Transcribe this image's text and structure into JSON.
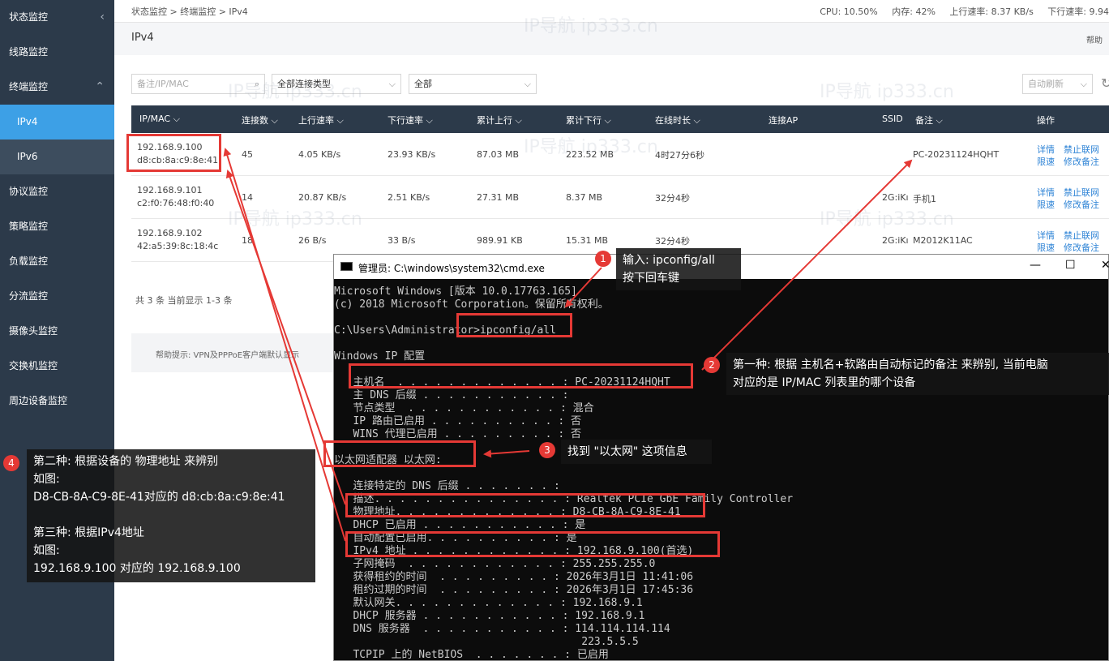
{
  "sidebar": {
    "items": [
      {
        "label": "状态监控",
        "chev": "‹"
      },
      {
        "label": "线路监控",
        "chev": ""
      },
      {
        "label": "终端监控",
        "chev": "⌃"
      },
      {
        "label": "IPv4",
        "chev": ""
      },
      {
        "label": "IPv6",
        "chev": ""
      },
      {
        "label": "协议监控",
        "chev": ""
      },
      {
        "label": "策略监控",
        "chev": ""
      },
      {
        "label": "负载监控",
        "chev": ""
      },
      {
        "label": "分流监控",
        "chev": ""
      },
      {
        "label": "摄像头监控",
        "chev": ""
      },
      {
        "label": "交换机监控",
        "chev": ""
      },
      {
        "label": "周边设备监控",
        "chev": ""
      }
    ]
  },
  "topbar": {
    "breadcrumb": "状态监控 > 终端监控 > IPv4",
    "cpu": "CPU: 10.50%",
    "mem": "内存: 42%",
    "up": "上行速率: 8.37 KB/s",
    "down": "下行速率: 9.94"
  },
  "page": {
    "title": "IPv4",
    "help": "帮助"
  },
  "filters": {
    "search_placeholder": "备注/IP/MAC",
    "conn_type": "全部连接类型",
    "all": "全部",
    "refresh": "自动刷新"
  },
  "table": {
    "headers": [
      "IP/MAC ⌵",
      "连接数 ⌵",
      "上行速率 ⌵",
      "下行速率 ⌵",
      "累计上行 ⌵",
      "累计下行 ⌵",
      "在线时长 ⌵",
      "连接AP",
      "SSID",
      "备注 ⌵",
      "操作"
    ],
    "rows": [
      {
        "ip": "192.168.9.100",
        "mac": "d8:cb:8a:c9:8e:41",
        "conn": "45",
        "up": "4.05 KB/s",
        "down": "23.93 KB/s",
        "tup": "87.03 MB",
        "tdown": "223.52 MB",
        "online": "4时27分6秒",
        "ssid": "",
        "note": "PC-20231124HQHT",
        "op1": "详情",
        "op2": "禁止联网",
        "op3": "限速",
        "op4": "修改备注"
      },
      {
        "ip": "192.168.9.101",
        "mac": "c2:f0:76:48:f0:40",
        "conn": "14",
        "up": "20.87 KB/s",
        "down": "2.51 KB/s",
        "tup": "27.31 MB",
        "tdown": "8.37 MB",
        "online": "32分4秒",
        "ssid": "2G:iKı",
        "note": "手机1",
        "op1": "详情",
        "op2": "禁止联网",
        "op3": "限速",
        "op4": "修改备注"
      },
      {
        "ip": "192.168.9.102",
        "mac": "42:a5:39:8c:18:4c",
        "conn": "18",
        "up": "26 B/s",
        "down": "33 B/s",
        "tup": "989.91 KB",
        "tdown": "15.31 MB",
        "online": "32分4秒",
        "ssid": "2G:iKı",
        "note": "M2012K11AC",
        "op1": "详情",
        "op2": "禁止联网",
        "op3": "限速",
        "op4": "修改备注"
      }
    ],
    "footer": "共 3 条 当前显示 1-3 条",
    "tip": "帮助提示:  VPN及PPPoE客户端默认显示"
  },
  "watermark": "IP导航  ip333.cn",
  "cmd": {
    "title": "管理员: C:\\windows\\system32\\cmd.exe",
    "min": "—",
    "max": "☐",
    "close": "✕",
    "lines": [
      "Microsoft Windows [版本 10.0.17763.165]",
      "(c) 2018 Microsoft Corporation。保留所有权利。",
      "",
      "C:\\Users\\Administrator>ipconfig/all",
      "",
      "Windows IP 配置",
      "",
      "   主机名  . . . . . . . . . . . . . : PC-20231124HQHT",
      "   主 DNS 后缀 . . . . . . . . . . . :",
      "   节点类型  . . . . . . . . . . . . : 混合",
      "   IP 路由已启用 . . . . . . . . . . : 否",
      "   WINS 代理已启用 . . . . . . . . . : 否",
      "",
      "以太网适配器 以太网:",
      "",
      "   连接特定的 DNS 后缀 . . . . . . . :",
      "   描述. . . . . . . . . . . . . . . : Realtek PCIe GbE Family Controller",
      "   物理地址. . . . . . . . . . . . . : D8-CB-8A-C9-8E-41",
      "   DHCP 已启用 . . . . . . . . . . . : 是",
      "   自动配置已启用. . . . . . . . . . : 是",
      "   IPv4 地址 . . . . . . . . . . . . : 192.168.9.100(首选)",
      "   子网掩码  . . . . . . . . . . . . : 255.255.255.0",
      "   获得租约的时间  . . . . . . . . . : 2026年3月1日 11:41:06",
      "   租约过期的时间  . . . . . . . . . : 2026年3月1日 17:45:36",
      "   默认网关. . . . . . . . . . . . . : 192.168.9.1",
      "   DHCP 服务器 . . . . . . . . . . . : 192.168.9.1",
      "   DNS 服务器  . . . . . . . . . . . : 114.114.114.114",
      "                                       223.5.5.5",
      "   TCPIP 上的 NetBIOS  . . . . . . . : 已启用"
    ]
  },
  "callouts": {
    "c1": {
      "num": "1",
      "line1": "输入: ipconfig/all",
      "line2": "按下回车键"
    },
    "c2": {
      "num": "2",
      "line1": "第一种: 根据 主机名+软路由自动标记的备注 来辨别, 当前电脑",
      "line2": "对应的是 IP/MAC 列表里的哪个设备"
    },
    "c3": {
      "num": "3",
      "line1": "找到 \"以太网\" 这项信息"
    },
    "c4": {
      "num": "4",
      "lines": [
        "第二种: 根据设备的 物理地址 来辨别",
        "如图:",
        "D8-CB-8A-C9-8E-41对应的 d8:cb:8a:c9:8e:41",
        "",
        "第三种: 根据IPv4地址",
        "如图:",
        "192.168.9.100 对应的 192.168.9.100"
      ]
    }
  }
}
